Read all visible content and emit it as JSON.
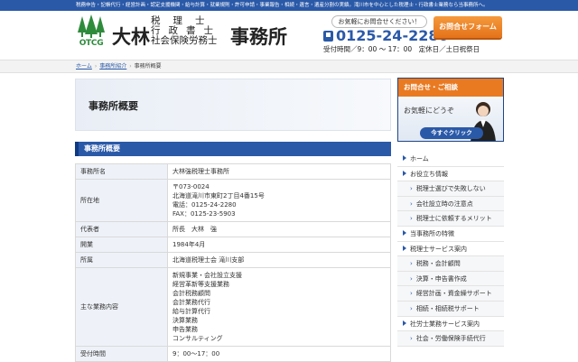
{
  "topbar": {
    "text": "税務申告・記帳代行・経営計画・認定支援機関・給与計算・就業規則・許可申請・事業報告・相続・遺言・遺産分割の実績。滝川市を中心とした税理士・行政書士業務なら当事務所へ。"
  },
  "header": {
    "logo_text": "OTCG",
    "firm_big": "大林",
    "firm_lines": [
      "税理士",
      "行政書士",
      "社会保険労務士"
    ],
    "firm_office": "事務所",
    "contact_prompt": "お気軽にお問合せください！",
    "phone": "0125-24-2280",
    "hours": "受付時間／9：00 ～ 17：00　定休日／土日祝祭日",
    "form_button": "お問合せフォーム"
  },
  "breadcrumb": {
    "items": [
      "ホーム",
      "事務所紹介",
      "事務所概要"
    ]
  },
  "main": {
    "page_title": "事務所概要",
    "section_heading": "事務所概要",
    "rows": [
      {
        "key": "事務所名",
        "value": [
          "大林強税理士事務所"
        ]
      },
      {
        "key": "所在地",
        "value": [
          "〒073-0024",
          "北海道滝川市東町2丁目4番15号",
          "電話：0125-24-2280",
          "FAX：0125-23-5903"
        ]
      },
      {
        "key": "代表者",
        "value": [
          "所長　大林　強"
        ]
      },
      {
        "key": "開業",
        "value": [
          "1984年4月"
        ]
      },
      {
        "key": "所属",
        "value": [
          "北海道税理士会 滝川支部"
        ]
      },
      {
        "key": "主な業務内容",
        "value": [
          "新規事業・会社設立支援",
          "経営革新等支援業務",
          "会計税務顧問",
          "会計業務代行",
          "給与計算代行",
          "決算業務",
          "申告業務",
          "コンサルティング"
        ]
      },
      {
        "key": "受付時間",
        "value": [
          "9：00～17：00"
        ]
      }
    ]
  },
  "sidebar": {
    "banner_heading": "お問合せ・ご相談",
    "banner_message": "お気軽にどうぞ",
    "banner_button": "今すぐクリック",
    "menu": [
      {
        "label": "ホーム",
        "level": "top"
      },
      {
        "label": "お役立ち情報",
        "level": "top"
      },
      {
        "label": "税理士選びで失敗しない",
        "level": "sub"
      },
      {
        "label": "会社設立時の注意点",
        "level": "sub"
      },
      {
        "label": "税理士に依頼するメリット",
        "level": "sub"
      },
      {
        "label": "当事務所の特徴",
        "level": "top"
      },
      {
        "label": "税理士サービス案内",
        "level": "top"
      },
      {
        "label": "税務・会計顧問",
        "level": "sub"
      },
      {
        "label": "決算・申告書作成",
        "level": "sub"
      },
      {
        "label": "経営計画・資金繰サポート",
        "level": "sub"
      },
      {
        "label": "相続・相続税サポート",
        "level": "sub"
      },
      {
        "label": "社労士業務サービス案内",
        "level": "top"
      },
      {
        "label": "社会・労働保険手続代行",
        "level": "sub"
      }
    ]
  },
  "colors": {
    "primary": "#2a59a8",
    "accent": "#e97a22",
    "logo_green": "#2e8b3c"
  },
  "icons": {
    "phone": "phone-icon",
    "logo": "tree-logo-icon",
    "person": "person-icon"
  }
}
